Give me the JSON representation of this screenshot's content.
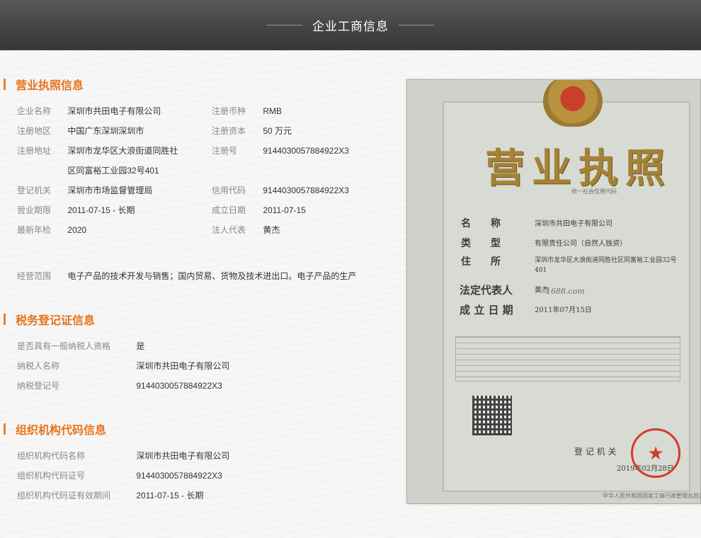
{
  "banner": {
    "title": "企业工商信息"
  },
  "business_license": {
    "title": "营业执照信息",
    "left_rows": [
      {
        "label": "企业名称",
        "value": "深圳市共田电子有限公司"
      },
      {
        "label": "注册地区",
        "value": "中国广东深圳深圳市"
      },
      {
        "label": "注册地址",
        "value": "深圳市龙华区大浪街道同胜社"
      },
      {
        "label": "",
        "value": "区同富裕工业园32号401"
      },
      {
        "label": "登记机关",
        "value": "深圳市市场监督管理局"
      },
      {
        "label": "营业期限",
        "value": "2011-07-15 - 长期"
      },
      {
        "label": "最新年检",
        "value": "2020"
      }
    ],
    "right_rows": [
      {
        "label": "注册币种",
        "value": "RMB"
      },
      {
        "label": "注册资本",
        "value": "50 万元"
      },
      {
        "label": "注册号",
        "value": "9144030057884922X3"
      },
      {
        "label": "信用代码",
        "value": "9144030057884922X3"
      },
      {
        "label": "成立日期",
        "value": "2011-07-15"
      },
      {
        "label": "法人代表",
        "value": "黄杰"
      }
    ],
    "scope": {
      "label": "经营范围",
      "value": "电子产品的技术开发与销售；国内贸易、货物及技术进出口。电子产品的生产"
    }
  },
  "tax": {
    "title": "税务登记证信息",
    "rows": [
      {
        "label": "是否具有一般纳税人资格",
        "value": "是"
      },
      {
        "label": "纳税人名称",
        "value": "深圳市共田电子有限公司"
      },
      {
        "label": "纳税登记号",
        "value": "9144030057884922X3"
      }
    ]
  },
  "org_code": {
    "title": "组织机构代码信息",
    "rows": [
      {
        "label": "组织机构代码名称",
        "value": "深圳市共田电子有限公司"
      },
      {
        "label": "组织机构代码证号",
        "value": "9144030057884922X3"
      },
      {
        "label": "组织机构代码证有效期间",
        "value": "2011-07-15 - 长期"
      }
    ]
  },
  "certificate": {
    "title": "营业执照",
    "credit_code_label": "统一社会信用代码",
    "field_name": "名　　称",
    "field_type": "类　　型",
    "field_address": "住　　所",
    "field_legal": "法定代表人",
    "field_date": "成 立 日 期",
    "name_value": "深圳市共田电子有限公司",
    "type_value": "有限责任公司（自然人独资）",
    "address_value": "深圳市龙华区大浪街道同胜社区同富裕工业园32号401",
    "legal_value": "黄杰",
    "watermark": "1688.com",
    "date_value": "2011年07月15日",
    "authority_label": "登 记 机 关",
    "issue_date": "2019年02月28日",
    "footer": "中华人民共和国国家工商行政管理总局监制",
    "seal_icon": "star"
  }
}
